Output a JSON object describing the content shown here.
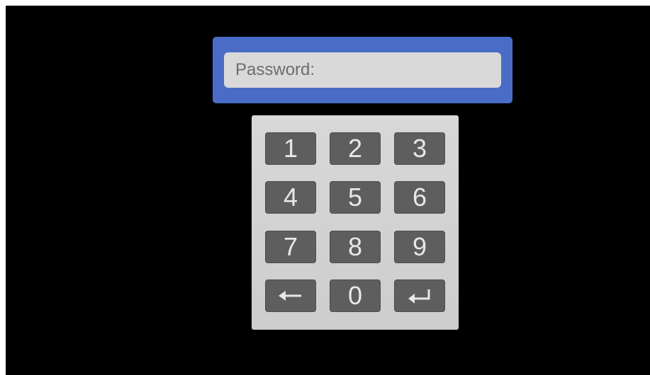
{
  "password": {
    "label": "Password:",
    "value": ""
  },
  "keypad": {
    "keys": [
      {
        "label": "1"
      },
      {
        "label": "2"
      },
      {
        "label": "3"
      },
      {
        "label": "4"
      },
      {
        "label": "5"
      },
      {
        "label": "6"
      },
      {
        "label": "7"
      },
      {
        "label": "8"
      },
      {
        "label": "9"
      },
      {
        "icon": "backspace-arrow-icon"
      },
      {
        "label": "0"
      },
      {
        "icon": "enter-return-icon"
      }
    ]
  },
  "colors": {
    "screen_background": "#000000",
    "panel_blue": "#4a6cc6",
    "field_gray": "#d9d9d9",
    "keypad_gray": "#d2d2d2",
    "key_dark": "#5e5e5e",
    "key_text": "#e8e8e8"
  }
}
